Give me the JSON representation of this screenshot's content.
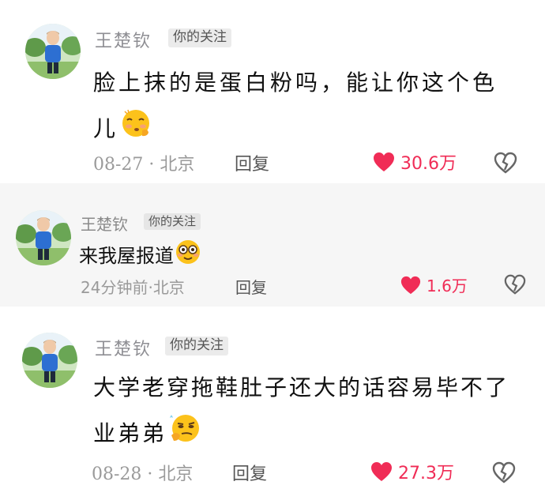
{
  "comments": [
    {
      "username": "王楚钦",
      "tag": "你的关注",
      "text": "脸上抹的是蛋白粉吗，能让你这个色儿",
      "emoji": "shushing-face-emoji",
      "date": "08-27",
      "location": "北京",
      "reply_label": "回复",
      "likes": "30.6万"
    },
    {
      "username": "王楚钦",
      "tag": "你的关注",
      "text": "来我屋报道",
      "emoji": "flushed-face-emoji",
      "date": "24分钟前",
      "location": "北京",
      "reply_label": "回复",
      "likes": "1.6万"
    },
    {
      "username": "王楚钦",
      "tag": "你的关注",
      "text": "大学老穿拖鞋肚子还大的话容易毕不了业弟弟",
      "emoji": "smirking-thinking-face-emoji",
      "date": "08-28",
      "location": "北京",
      "reply_label": "回复",
      "likes": "27.3万"
    }
  ],
  "colors": {
    "like_red": "#f02c56",
    "meta_gray": "#9a9a9a",
    "highlight_bg": "#f6f6f6"
  }
}
